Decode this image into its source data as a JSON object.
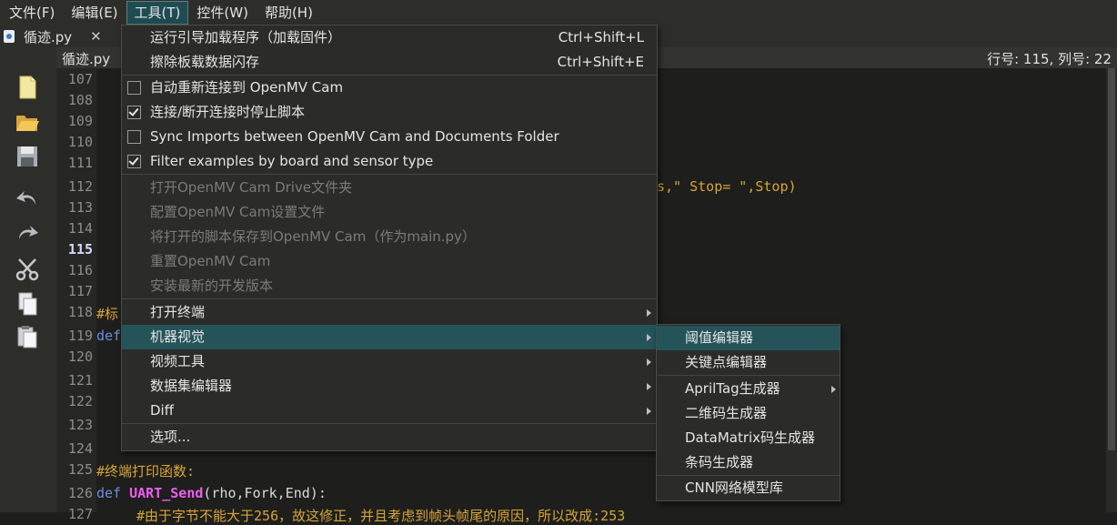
{
  "menubar": {
    "items": [
      "文件(F)",
      "编辑(E)",
      "工具(T)",
      "控件(W)",
      "帮助(H)"
    ]
  },
  "file_tab": {
    "name": "循迹.py",
    "close": "✕"
  },
  "editor": {
    "tab_name": "循迹.py",
    "cursor_position": "行号: 115, 列号: 22",
    "line_numbers": [
      "107",
      "108",
      "109",
      "110",
      "111",
      "112",
      "113",
      "114",
      "115",
      "116",
      "117",
      "118",
      "119",
      "120",
      "121",
      "122",
      "123",
      "124",
      "125",
      "126",
      "127"
    ],
    "current_line": "115",
    "visible_code": {
      "l112_tail": "s,\" Stop= \",Stop)",
      "l118_head": "#标",
      "l119_head": "def",
      "l125": "#终端打印函数:",
      "l126_kw": "def",
      "l126_fn": "UART_Send",
      "l126_rest": "(rho,Fork,End):",
      "l127_partial": "#由于字节不能大于256，故这修正，并且考虑到帧头帧尾的原因，所以改成:253"
    }
  },
  "tools_menu": {
    "items": [
      {
        "label": "运行引导加载程序（加载固件）",
        "shortcut": "Ctrl+Shift+L"
      },
      {
        "label": "擦除板载数据闪存",
        "shortcut": "Ctrl+Shift+E"
      },
      {
        "label": "自动重新连接到 OpenMV Cam",
        "checked": false
      },
      {
        "label": "连接/断开连接时停止脚本",
        "checked": true
      },
      {
        "label": "Sync Imports between OpenMV Cam and Documents Folder",
        "checked": false
      },
      {
        "label": "Filter examples by board and sensor type",
        "checked": true
      },
      {
        "label": "打开OpenMV Cam Drive文件夹",
        "disabled": true
      },
      {
        "label": "配置OpenMV Cam设置文件",
        "disabled": true
      },
      {
        "label": "将打开的脚本保存到OpenMV Cam（作为main.py）",
        "disabled": true
      },
      {
        "label": "重置OpenMV Cam",
        "disabled": true
      },
      {
        "label": "安装最新的开发版本",
        "disabled": true
      },
      {
        "label": "打开终端",
        "submenu": true
      },
      {
        "label": "机器视觉",
        "submenu": true,
        "highlighted": true
      },
      {
        "label": "视频工具",
        "submenu": true
      },
      {
        "label": "数据集编辑器",
        "submenu": true
      },
      {
        "label": "Diff",
        "submenu": true
      },
      {
        "label": "选项..."
      }
    ]
  },
  "machine_vision_submenu": {
    "items": [
      {
        "label": "阈值编辑器",
        "highlighted": true
      },
      {
        "label": "关键点编辑器"
      },
      {
        "label": "AprilTag生成器",
        "submenu": true
      },
      {
        "label": "二维码生成器"
      },
      {
        "label": "DataMatrix码生成器"
      },
      {
        "label": "条码生成器"
      },
      {
        "label": "CNN网络模型库"
      }
    ]
  },
  "colors": {
    "menu_highlight": "#24545a",
    "keyword": "#6c8de0",
    "function": "#f05cf0",
    "comment": "#d7a43a"
  }
}
